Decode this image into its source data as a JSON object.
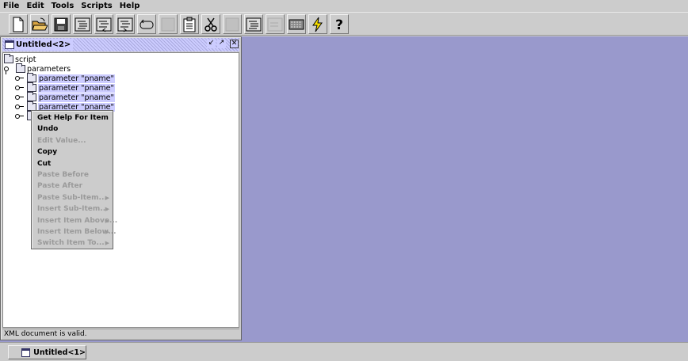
{
  "menubar": {
    "items": [
      "File",
      "Edit",
      "Tools",
      "Scripts",
      "Help"
    ]
  },
  "toolbar": {
    "buttons": [
      {
        "icon": "new-document-icon",
        "enabled": true
      },
      {
        "icon": "open-folder-icon",
        "enabled": true
      },
      {
        "icon": "save-disk-icon",
        "enabled": true
      },
      {
        "icon": "tree-item-icon",
        "enabled": true
      },
      {
        "icon": "tree-insert-icon",
        "enabled": true
      },
      {
        "icon": "tree-append-icon",
        "enabled": true
      },
      {
        "icon": "loop-icon",
        "enabled": true
      },
      {
        "icon": "blank-icon",
        "enabled": false
      },
      {
        "icon": "clipboard-icon",
        "enabled": true
      },
      {
        "icon": "scissors-icon",
        "enabled": true
      },
      {
        "icon": "paste-icon",
        "enabled": false
      },
      {
        "icon": "tree-paste-icon",
        "enabled": true
      },
      {
        "icon": "tree-disabled-icon",
        "enabled": false
      },
      {
        "icon": "keyboard-icon",
        "enabled": true
      },
      {
        "icon": "lightning-icon",
        "enabled": true
      },
      {
        "icon": "help-question-icon",
        "enabled": true
      }
    ]
  },
  "frame": {
    "title": "Untitled<2>",
    "status": "XML document is valid."
  },
  "tree": {
    "root": "script",
    "parameters": "parameters",
    "children": [
      "parameter \"pname\"",
      "parameter \"pname\"",
      "parameter \"pname\"",
      "parameter \"pname\""
    ]
  },
  "context_menu": {
    "items": [
      {
        "label": "Get Help For Item",
        "enabled": true,
        "submenu": false
      },
      {
        "label": "Undo",
        "enabled": true,
        "submenu": false
      },
      {
        "label": "Edit Value...",
        "enabled": false,
        "submenu": false
      },
      {
        "label": "Copy",
        "enabled": true,
        "submenu": false
      },
      {
        "label": "Cut",
        "enabled": true,
        "submenu": false
      },
      {
        "label": "Paste Before",
        "enabled": false,
        "submenu": false
      },
      {
        "label": "Paste After",
        "enabled": false,
        "submenu": false
      },
      {
        "label": "Paste Sub-Item...",
        "enabled": false,
        "submenu": true
      },
      {
        "label": "Insert Sub-Item...",
        "enabled": false,
        "submenu": true
      },
      {
        "label": "Insert Item Above...",
        "enabled": false,
        "submenu": true
      },
      {
        "label": "Insert Item Below...",
        "enabled": false,
        "submenu": true
      },
      {
        "label": "Switch Item To...",
        "enabled": false,
        "submenu": true
      }
    ]
  },
  "dock": {
    "frames": [
      "Untitled<1>"
    ]
  },
  "colors": {
    "desktop": "#9999cc",
    "chrome": "#cccccc",
    "selection": "#ccccff"
  }
}
